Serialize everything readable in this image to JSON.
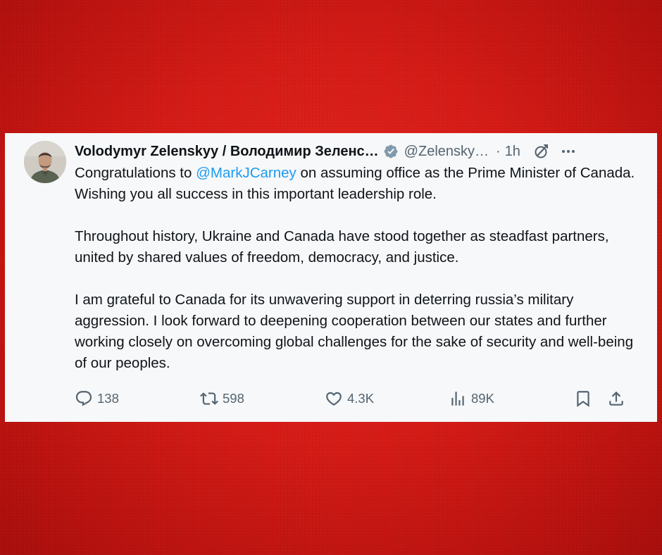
{
  "tweet": {
    "author_name": "Volodymyr Zelenskyy / Володимир Зеленс…",
    "handle": "@Zelensky…",
    "separator": "·",
    "time": "1h",
    "mention": "@MarkJCarney",
    "paragraphs": [
      {
        "before": "Congratulations to ",
        "after": " on assuming office as the Prime Minister of Canada. Wishing you all success in this important leadership role."
      },
      {
        "text": "Throughout history, Ukraine and Canada have stood together as steadfast partners, united by shared values of freedom, democracy, and justice."
      },
      {
        "text": "I am grateful to Canada for its unwavering support in deterring russia’s military aggression. I look forward to deepening cooperation between our states and further working closely on overcoming global challenges for the sake of security and well-being of our peoples."
      }
    ],
    "metrics": {
      "replies": "138",
      "reposts": "598",
      "likes": "4.3K",
      "views": "89K"
    }
  },
  "colors": {
    "background": "#d41813",
    "card": "#f7f8f9",
    "text": "#0f1419",
    "muted": "#536471",
    "link": "#1d9bf0"
  },
  "icons": {
    "verified": "verified-badge-icon",
    "grok": "grok-icon",
    "more": "more-icon",
    "reply": "reply-icon",
    "repost": "repost-icon",
    "like": "heart-icon",
    "views": "views-icon",
    "bookmark": "bookmark-icon",
    "share": "share-icon"
  }
}
